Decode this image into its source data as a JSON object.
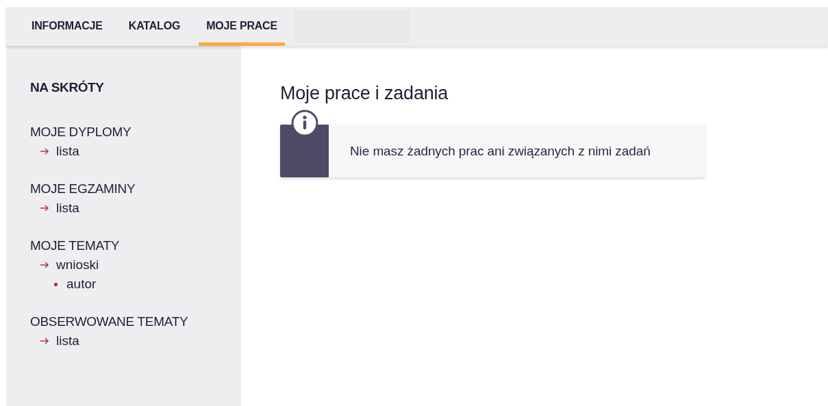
{
  "tabs": [
    {
      "label": "INFORMACJE",
      "selected": false
    },
    {
      "label": "KATALOG",
      "selected": false
    },
    {
      "label": "MOJE PRACE",
      "selected": true
    }
  ],
  "sidebar": {
    "title": "NA SKRÓTY",
    "sections": [
      {
        "label": "MOJE DYPLOMY",
        "children": [
          {
            "label": "lista"
          }
        ]
      },
      {
        "label": "MOJE EGZAMINY",
        "children": [
          {
            "label": "lista"
          }
        ]
      },
      {
        "label": "MOJE TEMATY",
        "children": [
          {
            "label": "wnioski",
            "children": [
              {
                "label": "autor"
              }
            ]
          }
        ]
      },
      {
        "label": "OBSERWOWANE TEMATY",
        "children": [
          {
            "label": "lista"
          }
        ]
      }
    ]
  },
  "main": {
    "heading": "Moje prace i zadania",
    "notice": {
      "kind": "info",
      "text": "Nie masz żadnych prac ani związanych z nimi zadań"
    }
  }
}
